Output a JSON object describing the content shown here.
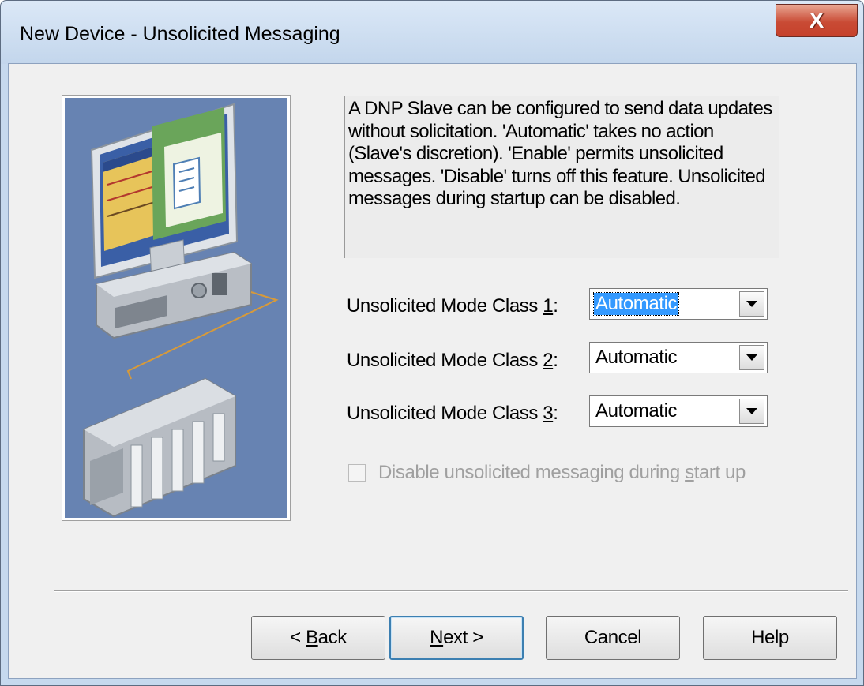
{
  "window": {
    "title": "New Device - Unsolicited Messaging",
    "close_label": "X"
  },
  "description": "A DNP Slave can be configured to send data updates without solicitation. 'Automatic' takes no action (Slave's discretion).  'Enable' permits unsolicited messages. 'Disable' turns off this feature. Unsolicited messages during startup can be disabled.",
  "fields": [
    {
      "label": "Unsolicited Mode Class 1:",
      "value": "Automatic",
      "focused": true
    },
    {
      "label": "Unsolicited Mode Class 2:",
      "value": "Automatic",
      "focused": false
    },
    {
      "label": "Unsolicited Mode Class 3:",
      "value": "Automatic",
      "focused": false
    }
  ],
  "checkbox": {
    "label": "Disable unsolicited messaging during start up",
    "checked": false,
    "enabled": false
  },
  "buttons": {
    "back": "< Back",
    "next": "Next >",
    "cancel": "Cancel",
    "help": "Help"
  },
  "icons": {
    "close": "close-icon",
    "dropdown": "chevron-down-icon",
    "illustration": "computer-plc-illustration"
  },
  "colors": {
    "illustration_bg": "#6783b2",
    "selection": "#3399ff",
    "close_button": "#c94b35"
  }
}
